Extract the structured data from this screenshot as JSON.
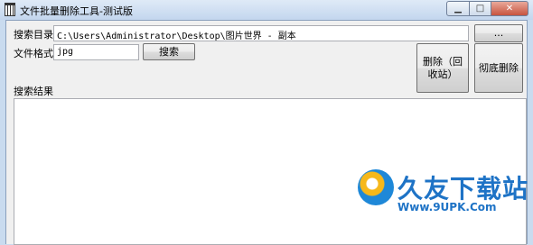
{
  "window": {
    "title": "文件批量删除工具-测试版",
    "minimize_glyph": "▁",
    "maximize_glyph": "□",
    "close_glyph": "✕"
  },
  "form": {
    "dir_label": "搜索目录",
    "dir_value": "C:\\Users\\Administrator\\Desktop\\图片世界 - 副本",
    "browse_label": "...",
    "format_label": "文件格式",
    "format_value": "jpg",
    "search_label": "搜索",
    "delete_recycle_label": "删除（回收站）",
    "delete_permanent_label": "彻底删除",
    "results_label": "搜索结果"
  },
  "watermark": {
    "name": "久友下载站",
    "url": "Www.9UPK.Com"
  }
}
